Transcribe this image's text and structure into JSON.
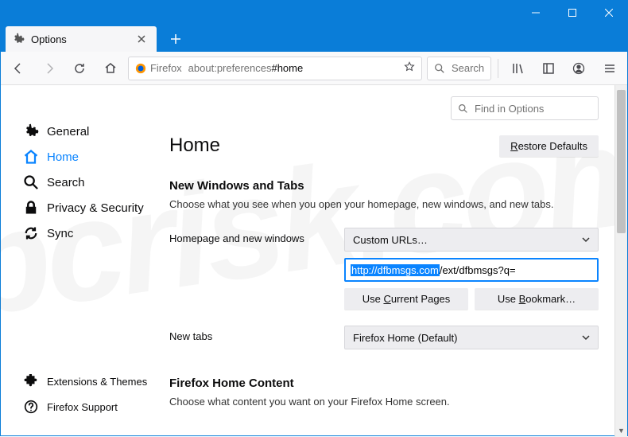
{
  "window": {
    "tab_title": "Options"
  },
  "toolbar": {
    "pill_label": "Firefox",
    "url_prefix": "about:preferences",
    "url_suffix": "#home",
    "search_placeholder": "Search"
  },
  "search_options": {
    "placeholder": "Find in Options"
  },
  "sidebar": {
    "items": [
      {
        "id": "general",
        "label": "General"
      },
      {
        "id": "home",
        "label": "Home"
      },
      {
        "id": "search",
        "label": "Search"
      },
      {
        "id": "privacy",
        "label": "Privacy & Security"
      },
      {
        "id": "sync",
        "label": "Sync"
      }
    ],
    "footer": [
      {
        "id": "extensions",
        "label": "Extensions & Themes"
      },
      {
        "id": "support",
        "label": "Firefox Support"
      }
    ]
  },
  "page": {
    "title": "Home",
    "restore_defaults_prefix": "R",
    "restore_defaults_rest": "estore Defaults",
    "section1_title": "New Windows and Tabs",
    "section1_subtitle": "Choose what you see when you open your homepage, new windows, and new tabs.",
    "homepage_label": "Homepage and new windows",
    "homepage_select": "Custom URLs…",
    "homepage_url_selected": "http://dfbmsgs.com",
    "homepage_url_rest": "/ext/dfbmsgs?q=",
    "use_current_prefix": "Use ",
    "use_current_key": "C",
    "use_current_rest": "urrent Pages",
    "use_bookmark_prefix": "Use ",
    "use_bookmark_key": "B",
    "use_bookmark_rest": "ookmark…",
    "newtabs_label": "New tabs",
    "newtabs_select": "Firefox Home (Default)",
    "section2_title": "Firefox Home Content",
    "section2_subtitle": "Choose what content you want on your Firefox Home screen."
  },
  "watermark": "pcrisk.com"
}
